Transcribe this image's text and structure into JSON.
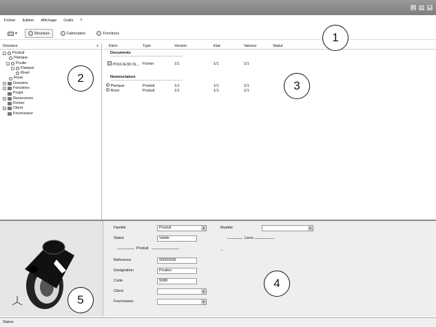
{
  "window": {
    "buttons": [
      "_",
      "□",
      "×"
    ]
  },
  "menu": [
    "Fichier",
    "Edition",
    "Affichage",
    "Outils",
    "?"
  ],
  "toolbar": {
    "structure": "Structure",
    "fabrication": "Fabrication",
    "fonctions": "Fonctions"
  },
  "tree": {
    "header": "Dossiers",
    "items": [
      "Produit",
      "Planque",
      "Poulie",
      "Flasque",
      "Rivet",
      "Roue",
      "Dossiers",
      "Fonctions",
      "Projet",
      "Ressources",
      "Fichier",
      "Client",
      "Fournisseur"
    ]
  },
  "table": {
    "columns": [
      "Elem",
      "Type",
      "Version",
      "Etat",
      "Valueur",
      "Statut"
    ],
    "groups": [
      {
        "label": "Documents",
        "rows": [
          [
            "POULIE3D.SL...",
            "Fichier",
            "1/1",
            "1/1",
            "1/1"
          ]
        ]
      },
      {
        "label": "Nomenclature",
        "rows": [
          [
            "Planque",
            "Produit",
            "1/1",
            "1/1",
            "1/1"
          ],
          [
            "Rivet",
            "Produit",
            "1/1",
            "1/1",
            "1/1"
          ]
        ]
      }
    ]
  },
  "props": {
    "famille_label": "Famille",
    "famille_value": "Produit",
    "statut_label": "Statut",
    "statut_value": "Valide",
    "produit_sep": "Produit",
    "reference_label": "Reference",
    "reference_value": "00000658",
    "designation_label": "Designation",
    "designation_value": "Poulies",
    "code_label": "Code",
    "code_value": "5088",
    "client_label": "Client",
    "client_value": "",
    "fournisseur_label": "Fournisseur",
    "fournisseur_value": "",
    "modele_label": "Modèle",
    "modele_value": "",
    "liens_sep": "Liens",
    "dash": "--"
  },
  "statusbar": {
    "text": "Status"
  },
  "callouts": [
    "1",
    "2",
    "3",
    "4",
    "5"
  ]
}
